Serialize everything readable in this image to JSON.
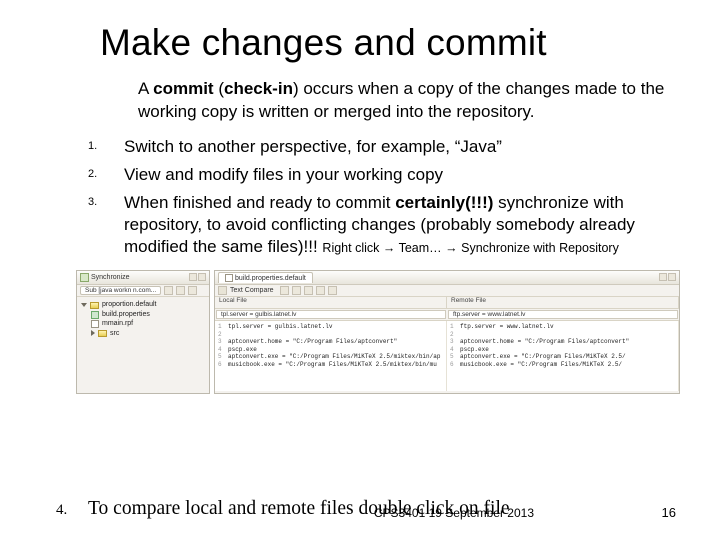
{
  "title": "Make changes and commit",
  "intro": {
    "lead": "A ",
    "bold": "commit",
    "paren": " (",
    "bold2": "check-in",
    "rest": ") occurs when a copy of the changes made to the working copy is written or merged into the repository."
  },
  "items": [
    {
      "n": "1.",
      "text": "Switch to another perspective, for example, “Java”"
    },
    {
      "n": "2.",
      "text": "View and modify files in your working copy"
    },
    {
      "n": "3.",
      "pre": "When finished and ready to commit ",
      "bold": "certainly(!!!)",
      "mid": " synchronize with repository, to avoid conflicting changes (probably somebody already modified the same files)!!! ",
      "small": "Right click → Team… → Synchronize with Repository"
    }
  ],
  "screenshot": {
    "left": {
      "title": "Synchronize",
      "selector": "Sub [java workn n.com...",
      "root": "proportion.default",
      "children": [
        "build.properties",
        "mmain.rpf",
        "src"
      ]
    },
    "right": {
      "tab": "build.properties.default",
      "compare": "Text Compare",
      "local": {
        "label": "Local File",
        "path": "tpl.server = gulbis.latnet.lv"
      },
      "remote": {
        "label": "Remote File",
        "path": "ftp.server = www.latnet.lv"
      },
      "lines": [
        "aptconvert.home = \"C:/Program Files/aptconvert\"",
        "pscp.exe",
        "aptconvert.exe = \"C:/Program Files/MiKTeX 2.5/miktex/bin/ap",
        "musicbook.exe = \"C:/Program Files/MiKTeX 2.5/miktex/bin/mu"
      ],
      "rlines": [
        "aptconvert.home = \"C:/Program Files/aptconvert\"",
        "pscp.exe",
        "aptconvert.exe = \"C:/Program Files/MiKTeX 2.5/",
        "musicbook.exe = \"C:/Program Files/MiKTeX 2.5/"
      ]
    }
  },
  "step4": {
    "n": "4.",
    "text": "To compare local and remote files double click on file"
  },
  "footer": {
    "course": "CPS3401  19 September 2013",
    "page": "16"
  }
}
